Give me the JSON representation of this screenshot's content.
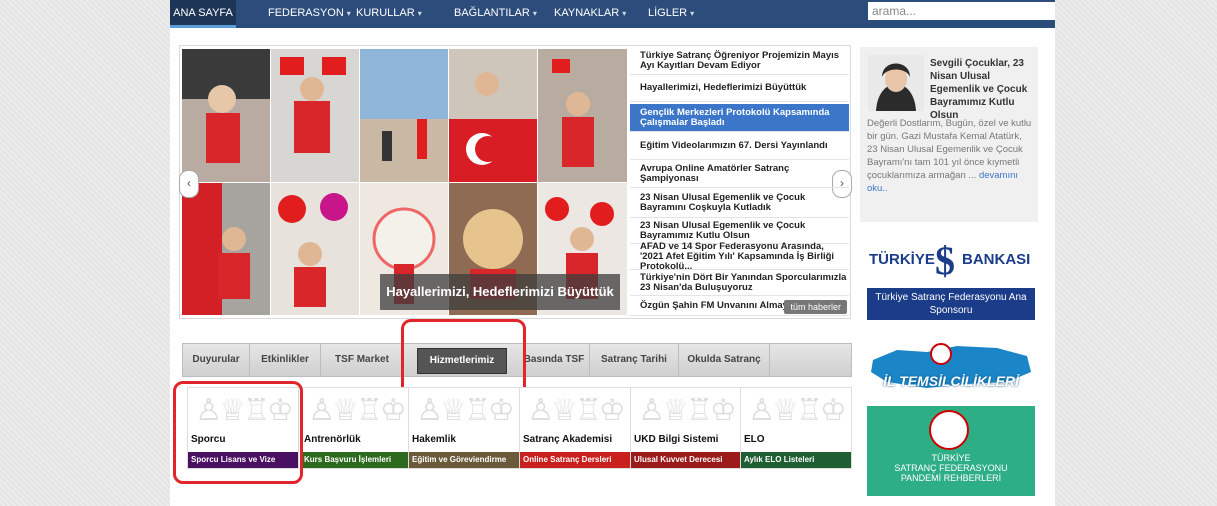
{
  "nav": {
    "items": [
      {
        "label": "ANA SAYFA",
        "arrow": ""
      },
      {
        "label": "FEDERASYON",
        "arrow": "▾"
      },
      {
        "label": "KURULLAR",
        "arrow": "▾"
      },
      {
        "label": "BAĞLANTILAR",
        "arrow": "▾"
      },
      {
        "label": "KAYNAKLAR",
        "arrow": "▾"
      },
      {
        "label": "LİGLER",
        "arrow": "▾"
      }
    ],
    "search_placeholder": "arama..."
  },
  "slider": {
    "caption": "Hayallerimizi, Hedeflerimizi Büyüttük",
    "headlines": [
      "Türkiye Satranç Öğreniyor Projemizin Mayıs Ayı Kayıtları Devam Ediyor",
      "Hayallerimizi, Hedeflerimizi Büyüttük",
      "Gençlik Merkezleri Protokolü Kapsamında Çalışmalar Başladı",
      "Eğitim Videolarımızın 67. Dersi Yayınlandı",
      "Avrupa Online Amatörler Satranç Şampiyonası",
      "23 Nisan Ulusal Egemenlik ve Çocuk Bayramını Coşkuyla Kutladık",
      "23 Nisan Ulusal Egemenlik ve Çocuk Bayramımız Kutlu Olsun",
      "AFAD ve 14 Spor Federasyonu Arasında, '2021 Afet Eğitim Yılı' Kapsamında İş Birliği Protokolü...",
      "Türkiye'nin Dört Bir Yanından Sporcularımızla 23 Nisan'da Buluşuyoruz",
      "Özgün Şahin FM Unvanını Almaya Hak"
    ],
    "active_index": 2,
    "more_label": "tüm haberler",
    "prev": "‹",
    "next": "›"
  },
  "tabs": [
    "Duyurular",
    "Etkinlikler",
    "TSF Market",
    "Hizmetlerimiz",
    "Basında TSF",
    "Satranç Tarihi",
    "Okulda Satranç"
  ],
  "active_tab": 3,
  "tiles": [
    {
      "title": "Sporcu",
      "subtitle": "Sporcu Lisans ve Vize",
      "color": "#4a1061"
    },
    {
      "title": "Antrenörlük",
      "subtitle": "Kurs Başvuru İşlemleri",
      "color": "#2d6a1f"
    },
    {
      "title": "Hakemlik",
      "subtitle": "Eğitim ve Göreviendirme",
      "color": "#6b5a3a"
    },
    {
      "title": "Satranç Akademisi",
      "subtitle": "Online Satranç Dersleri",
      "color": "#c8201d"
    },
    {
      "title": "UKD Bilgi Sistemi",
      "subtitle": "Ulusal Kuvvet Derecesi",
      "color": "#9b1b1b"
    },
    {
      "title": "ELO",
      "subtitle": "Aylık ELO Listeleri",
      "color": "#1f5e33"
    }
  ],
  "sidebar": {
    "article_title": "Sevgili Çocuklar, 23 Nisan Ulusal Egemenlik ve Çocuk Bayramımız Kutlu Olsun",
    "article_text": "Değerli Dostlarım, Bugün, özel ve kutlu bir gün. Gazi Mustafa Kemal Atatürk, 23 Nisan Ulusal Egemenlik ve Çocuk Bayramı'nı tam 101 yıl önce kıymetli çocuklarımıza armağan ...",
    "article_more": "devamını oku..",
    "bank_name": "TÜRKİYE",
    "bank_name2": "BANKASI",
    "sponsor_text": "Türkiye Satranç Federasyonu Ana Sponsoru",
    "il_text": "İL TEMSİLCİLİKLERİ",
    "pandemic_text1": "TÜRKİYE",
    "pandemic_text2": "SATRANÇ FEDERASYONU",
    "pandemic_text3": "PANDEMİ REHBERLERİ"
  },
  "colors": {
    "nav": "#2c4d7c",
    "highlight": "#e0262a",
    "active_headline": "#3c76c9"
  }
}
